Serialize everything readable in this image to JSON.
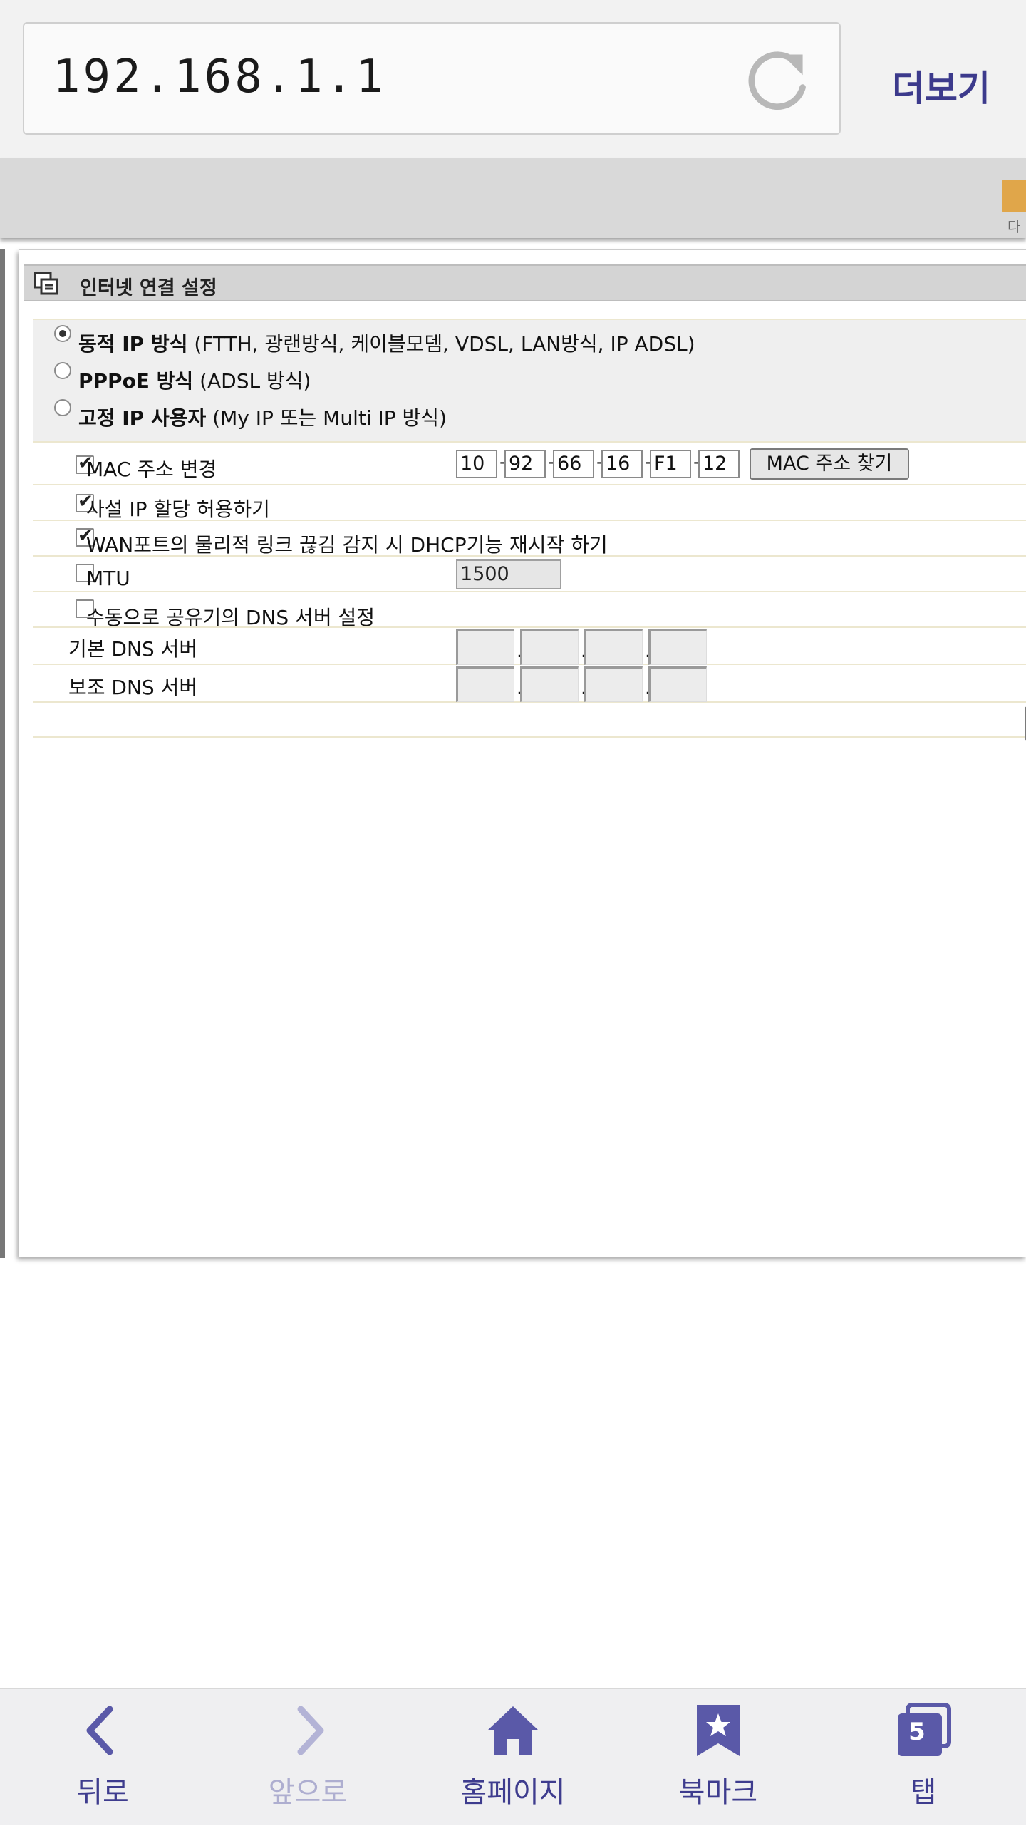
{
  "browser": {
    "url": "192.168.1.1",
    "more_label": "더보기",
    "corner_text": "다"
  },
  "panel": {
    "title": "인터넷 연결 설정",
    "modes": [
      {
        "bold": "동적 IP 방식",
        "rest": " (FTTH, 광랜방식, 케이블모뎀, VDSL, LAN방식, IP ADSL)",
        "selected": true
      },
      {
        "bold": "PPPoE 방식",
        "rest": " (ADSL 방식)",
        "selected": false
      },
      {
        "bold": "고정 IP 사용자",
        "rest": " (My IP 또는 Multi IP 방식)",
        "selected": false
      }
    ],
    "options": {
      "mac_change": {
        "label": "MAC 주소 변경",
        "checked": true
      },
      "mac_octets": [
        "10",
        "92",
        "66",
        "16",
        "F1",
        "12"
      ],
      "mac_find_button": "MAC 주소 찾기",
      "private_ip": {
        "label": "사설 IP 할당 허용하기",
        "checked": true
      },
      "wan_restart": {
        "label": "WAN포트의 물리적 링크 끊김 감지 시 DHCP기능 재시작 하기",
        "checked": true
      },
      "mtu": {
        "label": "MTU",
        "checked": false,
        "value": "1500"
      },
      "manual_dns": {
        "label": "수동으로 공유기의 DNS 서버 설정",
        "checked": false
      },
      "primary_dns_label": "기본 DNS 서버",
      "secondary_dns_label": "보조 DNS 서버"
    }
  },
  "bottom_nav": {
    "back": "뒤로",
    "forward": "앞으로",
    "home": "홈페이지",
    "bookmark": "북마크",
    "tabs": "탭",
    "tab_count": "5"
  },
  "colors": {
    "accent": "#3e3c8e",
    "accent_disabled": "#aeaed0",
    "icon_fill": "#5a59a8"
  }
}
